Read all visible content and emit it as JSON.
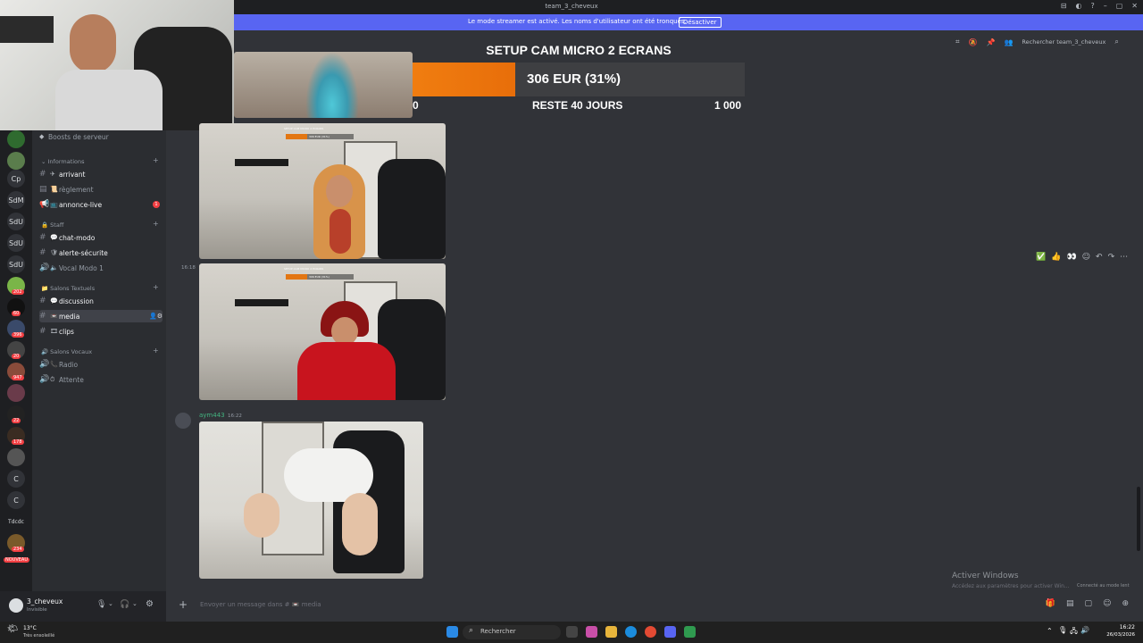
{
  "window": {
    "title": "team_3_cheveux",
    "controls": [
      "–",
      "▢",
      "✕"
    ],
    "titlebar_icons": [
      "⊟",
      "◐",
      "?"
    ]
  },
  "streamer_banner": {
    "message": "Le mode streamer est activé. Les noms d'utilisateur ont été tronqués.",
    "button": "Désactiver"
  },
  "header": {
    "search_placeholder": "Rechercher team_3_cheveux"
  },
  "server_rail": {
    "items": [
      {
        "label": "Cp"
      },
      {
        "label": "SdM"
      },
      {
        "label": "SdU"
      },
      {
        "label": "SdU"
      },
      {
        "label": "SdU"
      },
      {
        "label": "C"
      },
      {
        "label": "Tdcdc"
      }
    ],
    "badges": [
      "202",
      "60",
      "396",
      "20",
      "947",
      "22",
      "178",
      "234"
    ],
    "new_badge": "NOUVEAU"
  },
  "sidebar": {
    "boosts": "Boosts de serveur",
    "categories": [
      {
        "name": "Informations"
      },
      {
        "name": "Staff"
      },
      {
        "name": "Salons Textuels"
      },
      {
        "name": "Salons Vocaux"
      }
    ],
    "channels": [
      {
        "name": "arrivant"
      },
      {
        "name": "règlement"
      },
      {
        "name": "annonce-live",
        "mentions": "1"
      },
      {
        "name": "chat-modo"
      },
      {
        "name": "alerte-sécurite"
      },
      {
        "name": "Vocal Modo 1"
      },
      {
        "name": "discussion"
      },
      {
        "name": "media"
      },
      {
        "name": "clips"
      },
      {
        "name": "Radio"
      },
      {
        "name": "Attente"
      }
    ]
  },
  "user_panel": {
    "username": "3_cheveux",
    "status": "Invisible"
  },
  "chat": {
    "messages": [
      {
        "time": "16:18"
      },
      {
        "author": "aym443",
        "time": "16:22"
      }
    ],
    "input_placeholder": "Envoyer un message dans # 📼 media"
  },
  "donation_goal": {
    "title": "SETUP CAM MICRO 2 ECRANS",
    "current": "306 EUR (31%)",
    "progress": 0.31,
    "min": "0",
    "remaining": "RESTE 40 JOURS",
    "max": "1 000",
    "mini_title": "SETUP CAM MICRO 2 ECRANS",
    "mini_value": "306 EUR (31%)"
  },
  "windows_watermark": {
    "title": "Activer Windows",
    "subtitle": "Accédez aux paramètres pour activer Win..."
  },
  "hover_toast": "Connecté au mode lent",
  "taskbar": {
    "weather_temp": "13°C",
    "weather_desc": "Très ensoleillé",
    "search_label": "Rechercher",
    "time": "16:22",
    "date": "26/03/2026"
  },
  "colors": {
    "accent": "#5865f2",
    "goal_fill": "#f07d10",
    "mention": "#f23f43",
    "author": "#43b581"
  }
}
